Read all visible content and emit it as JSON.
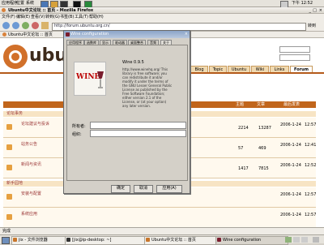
{
  "top_panel": {
    "menus": [
      "应用程序",
      "位置",
      "系统"
    ],
    "clock": "下午 12:52"
  },
  "firefox": {
    "window_title": "Ubuntu中文论坛 :: 首页 - Mozilla Firefox",
    "menus": [
      "文件(F)",
      "编辑(E)",
      "查看(V)",
      "转到(G)",
      "书签(B)",
      "工具(T)",
      "帮助(H)"
    ],
    "url": "http://forum.ubuntu.org.cn/",
    "go_label": "转到",
    "bookmark_label": "Ubuntu中文论坛 :: 首页",
    "status_text": "完成"
  },
  "forum": {
    "logo_text": "ubuntu",
    "nav_tabs": [
      "Blog",
      "Topic",
      "Ubuntu",
      "Wiki",
      "Links",
      "Forum"
    ],
    "col_headers": [
      "主题",
      "文章",
      "最后发表"
    ],
    "category1": "论坛事务",
    "category2": "新手园地",
    "rows": [
      {
        "title": "论坛建议与投诉",
        "topics": "2214",
        "posts": "13287",
        "last_date": "2006-1-24",
        "last_time": "12:57"
      },
      {
        "title": "站务公告",
        "topics": "57",
        "posts": "469",
        "last_date": "2006-1-24",
        "last_time": "12:41"
      },
      {
        "title": "新闻与资讯",
        "topics": "1417",
        "posts": "7815",
        "last_date": "2006-1-24",
        "last_time": "12:52"
      },
      {
        "title": "新手报到",
        "topics": "",
        "posts": "",
        "last_date": "",
        "last_time": ""
      },
      {
        "title": "安装与配置",
        "topics": "",
        "posts": "",
        "last_date": "2006-1-24",
        "last_time": "12:57"
      },
      {
        "title": "系统应用",
        "topics": "",
        "posts": "",
        "last_date": "2006-1-24",
        "last_time": "12:57"
      }
    ]
  },
  "wine_dialog": {
    "title": "Wine configuration",
    "tabs": [
      "应用程序",
      "函数库",
      "显示",
      "驱动器",
      "桌面整合",
      "音频",
      "关于"
    ],
    "logo_text": "WINE",
    "version": "Wine 0.9.5",
    "about_text": "http://www.winehq.org/ This library is free software; you can redistribute it and/or modify it under the terms of the GNU Lesser General Public License as published by the Free Software Foundation; either version 2.1 of the License, or (at your option) any later version.",
    "owner_label": "所有者:",
    "org_label": "组织:",
    "buttons": [
      "确定",
      "取消",
      "应用(A)"
    ]
  },
  "taskbar": {
    "tasks": [
      "jix - 文件浏览器",
      "[jix@ip-desktop: ~]",
      "Ubuntu中文论坛 :: 首页",
      "Wine configuration"
    ]
  }
}
